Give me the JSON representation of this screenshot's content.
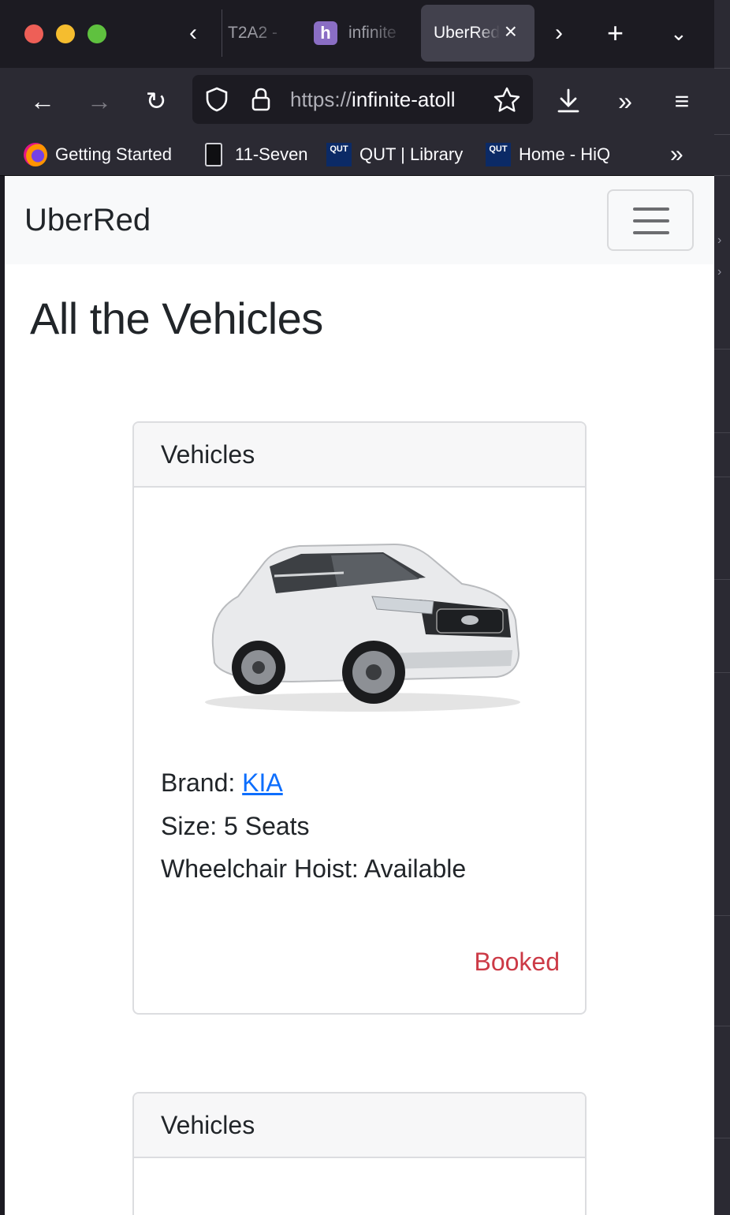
{
  "browser": {
    "tabs": [
      {
        "title": "T2A2 -"
      },
      {
        "title": "infinite"
      },
      {
        "title": "UberRed"
      }
    ],
    "url_scheme": "https://",
    "url_host": "infinite-atoll",
    "bookmarks": [
      {
        "label": "Getting Started",
        "icon": "firefox-icon"
      },
      {
        "label": "11-Seven",
        "icon": "fuel-pump-icon"
      },
      {
        "label": "QUT | Library",
        "icon": "qut-icon"
      },
      {
        "label": "Home - HiQ",
        "icon": "qut-icon"
      }
    ],
    "qut_icon_text": "QUT"
  },
  "site": {
    "brand": "UberRed",
    "page_title": "All the Vehicles"
  },
  "cards": [
    {
      "header": "Vehicles",
      "brand_label": "Brand: ",
      "brand_value": "KIA",
      "size": "Size: 5 Seats",
      "hoist": "Wheelchair Hoist: Available",
      "status": "Booked",
      "status_color": "#cc3a46"
    },
    {
      "header": "Vehicles"
    }
  ]
}
